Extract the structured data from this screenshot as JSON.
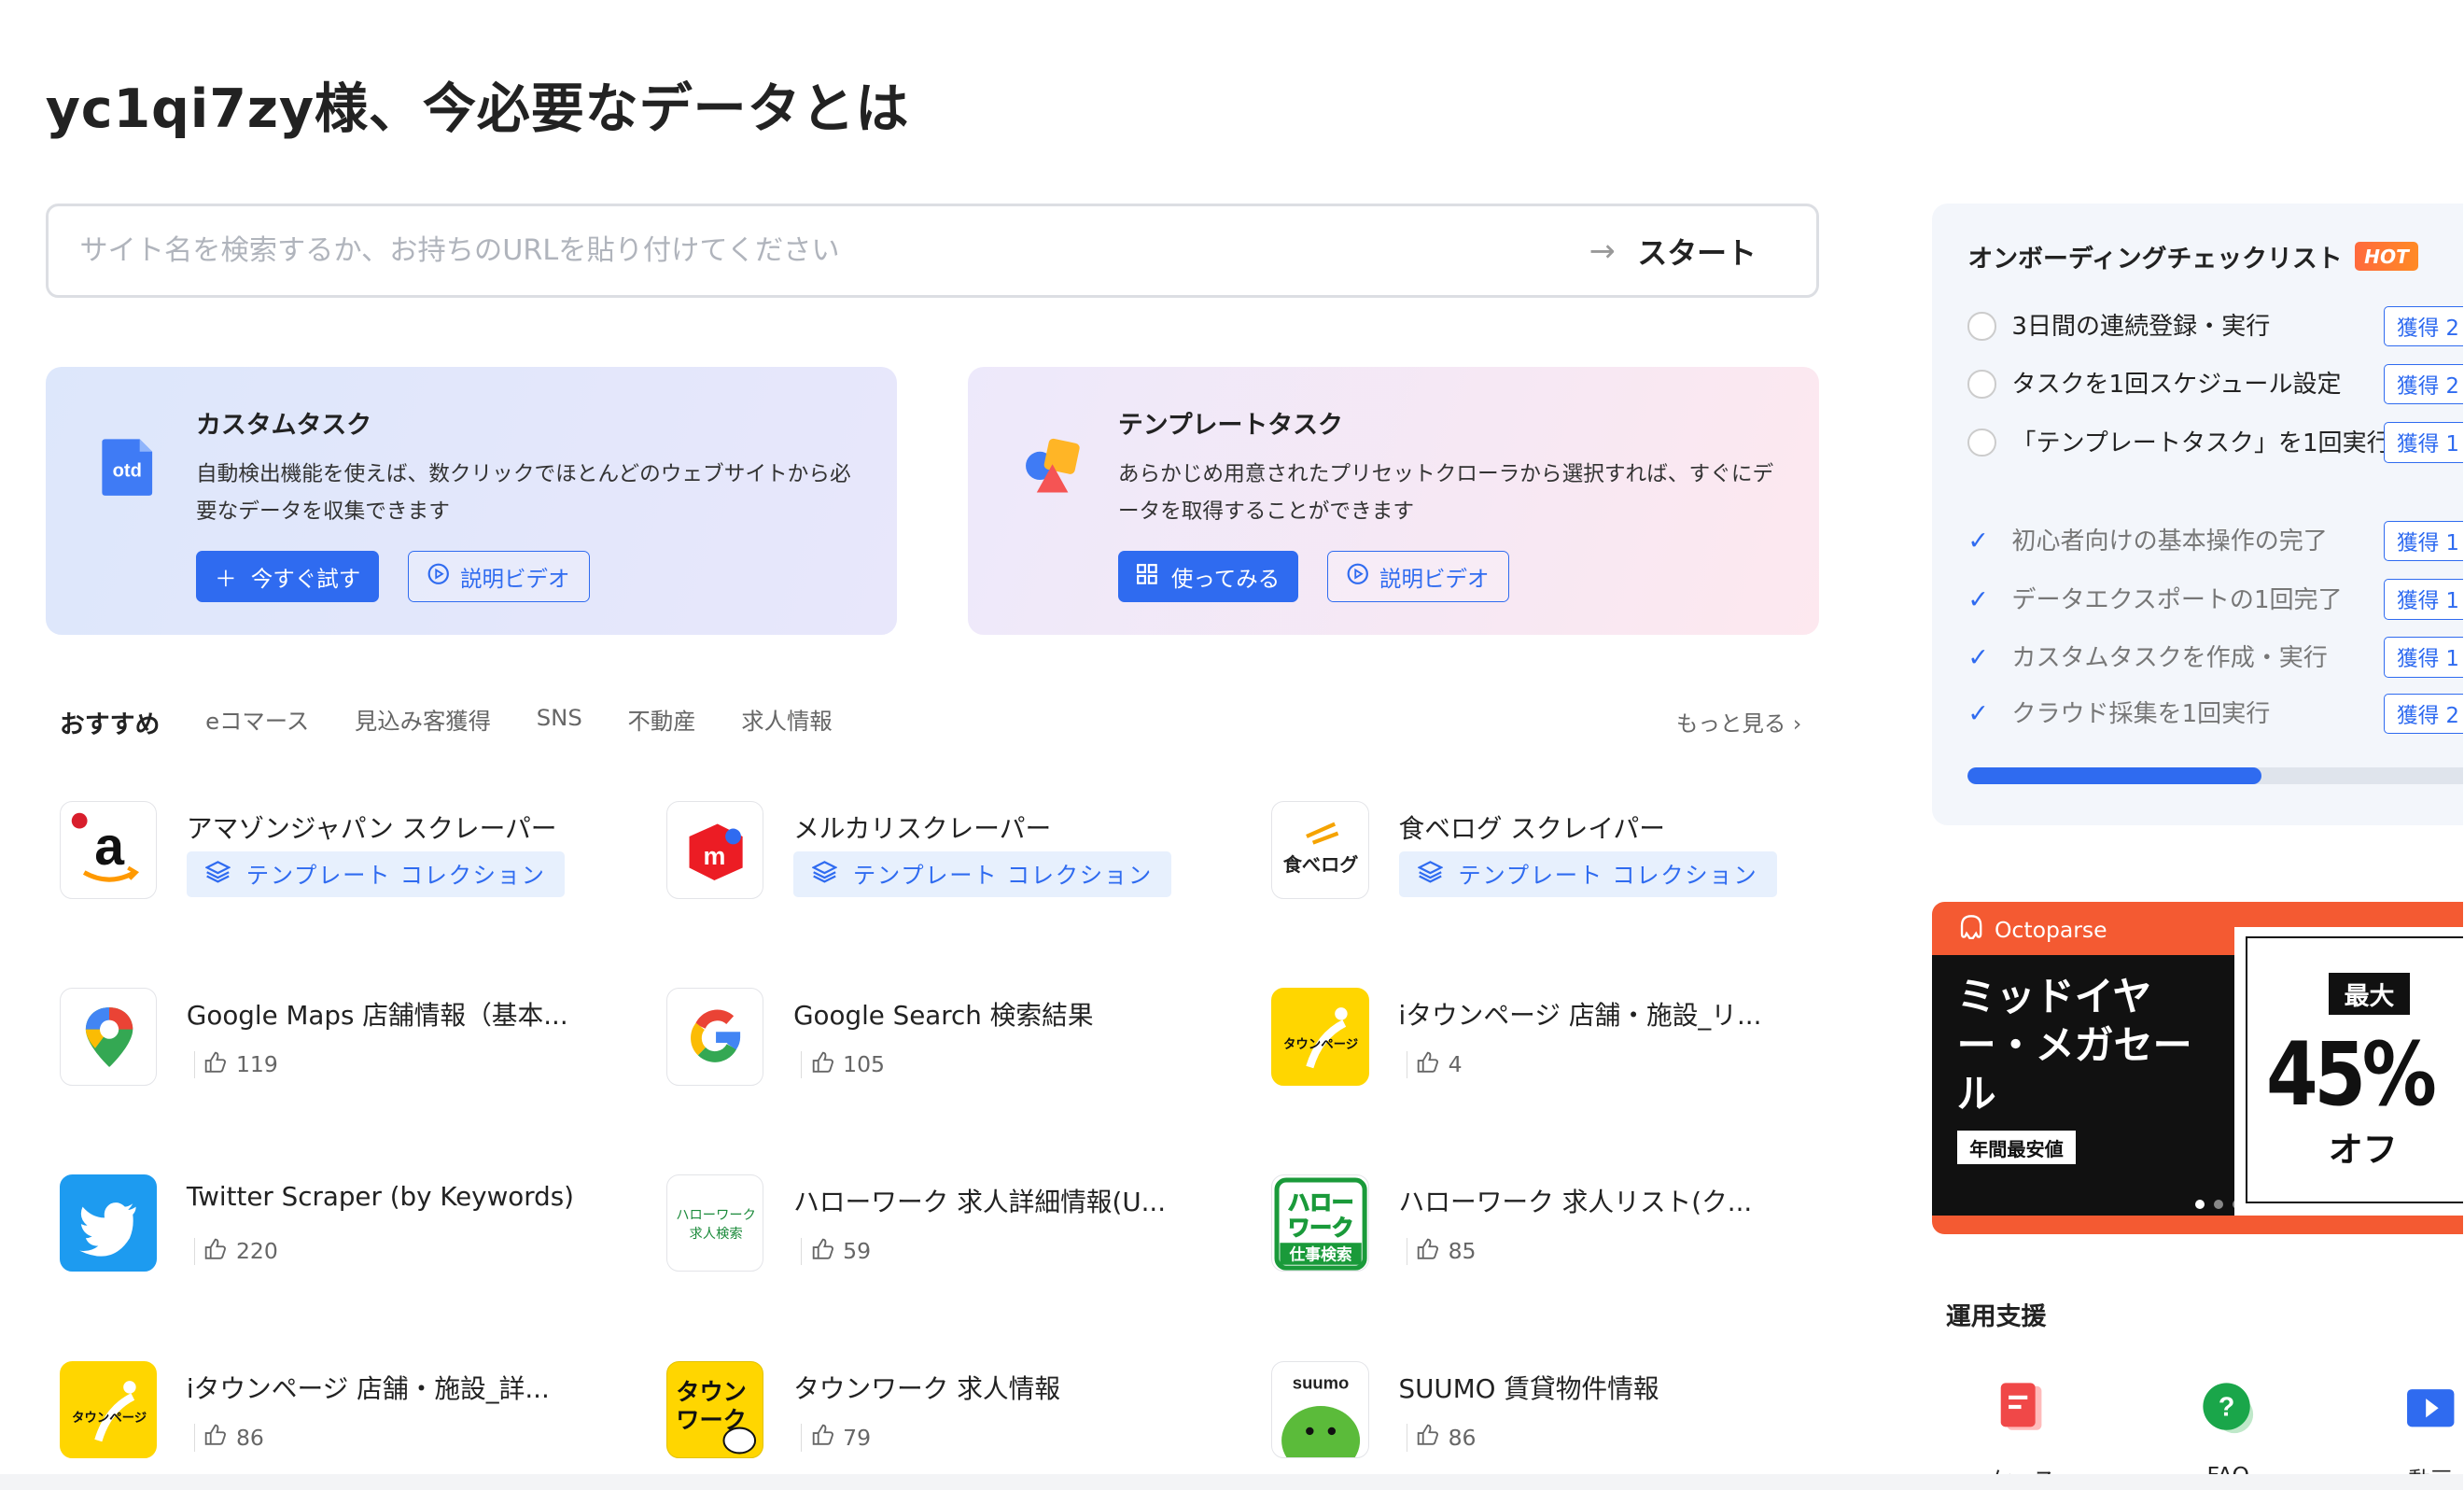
{
  "greeting": "yc1qi7zy様、今必要なデータとは",
  "search": {
    "placeholder": "サイト名を検索するか、お持ちのURLを貼り付けてください",
    "start_label": "スタート"
  },
  "custom_card": {
    "title": "カスタムタスク",
    "desc": "自動検出機能を使えば、数クリックでほとんどのウェブサイトから必要なデータを収集できます",
    "primary": "今すぐ試す",
    "video": "説明ビデオ",
    "icon": "otd"
  },
  "template_card": {
    "title": "テンプレートタスク",
    "desc": "あらかじめ用意されたプリセットクローラから選択すれば、すぐにデータを取得することができます",
    "primary": "使ってみる",
    "video": "説明ビデオ"
  },
  "tabs": [
    "おすすめ",
    "eコマース",
    "見込み客獲得",
    "SNS",
    "不動産",
    "求人情報"
  ],
  "more": "もっと見る",
  "tiles": [
    {
      "name": "アマゾンジャパン スクレーパー",
      "tag": "テンプレート コレクション",
      "logo": "amazon"
    },
    {
      "name": "メルカリスクレーパー",
      "tag": "テンプレート コレクション",
      "logo": "mercari"
    },
    {
      "name": "食ベログ スクレイパー",
      "tag": "テンプレート コレクション",
      "logo": "tabelog"
    },
    {
      "name": "Google Maps 店舗情報（基本...",
      "likes": "119",
      "logo": "gmaps"
    },
    {
      "name": "Google Search 検索結果",
      "likes": "105",
      "logo": "google"
    },
    {
      "name": "iタウンページ 店舗・施設_リ...",
      "likes": "4",
      "logo": "itown"
    },
    {
      "name": "Twitter Scraper (by Keywords)",
      "likes": "220",
      "logo": "twitter"
    },
    {
      "name": "ハローワーク 求人詳細情報(U...",
      "likes": "59",
      "logo": "hellowork"
    },
    {
      "name": "ハローワーク 求人リスト(ク...",
      "likes": "85",
      "logo": "hellowork2"
    },
    {
      "name": "iタウンページ 店舗・施設_詳...",
      "likes": "86",
      "logo": "itown"
    },
    {
      "name": "タウンワーク 求人情報",
      "likes": "79",
      "logo": "townwork"
    },
    {
      "name": "SUUMO 賃貸物件情報",
      "likes": "86",
      "logo": "suumo"
    }
  ],
  "logo_text": {
    "amazon": "a",
    "mercari": "m",
    "tabelog": "食べログ",
    "itown": "タウンページ",
    "hellowork_l1": "ハローワーク",
    "hellowork_l2": "求人検索",
    "hellowork2_l1": "ハロー",
    "hellowork2_l2": "ワーク",
    "hellowork2_l3": "仕事検索",
    "townwork_l1": "タウン",
    "townwork_l2": "ワーク",
    "suumo": "suumo"
  },
  "checklist": {
    "title": "オンボーディングチェックリスト",
    "badge": "HOT",
    "items": [
      {
        "label": "3日間の連続登録・実行",
        "done": false,
        "earn": "獲得 2"
      },
      {
        "label": "タスクを1回スケジュール設定",
        "done": false,
        "earn": "獲得 2"
      },
      {
        "label": "「テンプレートタスク」を1回実行",
        "done": false,
        "earn": "獲得 1"
      },
      {
        "label": "初心者向けの基本操作の完了",
        "done": true,
        "earn": "獲得 1"
      },
      {
        "label": "データエクスポートの1回完了",
        "done": true,
        "earn": "獲得 1"
      },
      {
        "label": "カスタムタスクを作成・実行",
        "done": true,
        "earn": "獲得 1"
      },
      {
        "label": "クラウド採集を1回実行",
        "done": true,
        "earn": "獲得 2"
      }
    ],
    "progress_pct": 55
  },
  "banner": {
    "brand": "Octoparse",
    "headline": "ミッドイヤー・メガセール",
    "sub": "年間最安値",
    "max": "最大",
    "pct": "45%",
    "off": "オフ"
  },
  "support": {
    "title": "運用支援",
    "items": [
      {
        "label": "ケース"
      },
      {
        "label": "FAQ"
      },
      {
        "label": "動画"
      }
    ]
  },
  "colors": {
    "accent": "#2f6bf0",
    "banner": "#f45a32"
  }
}
